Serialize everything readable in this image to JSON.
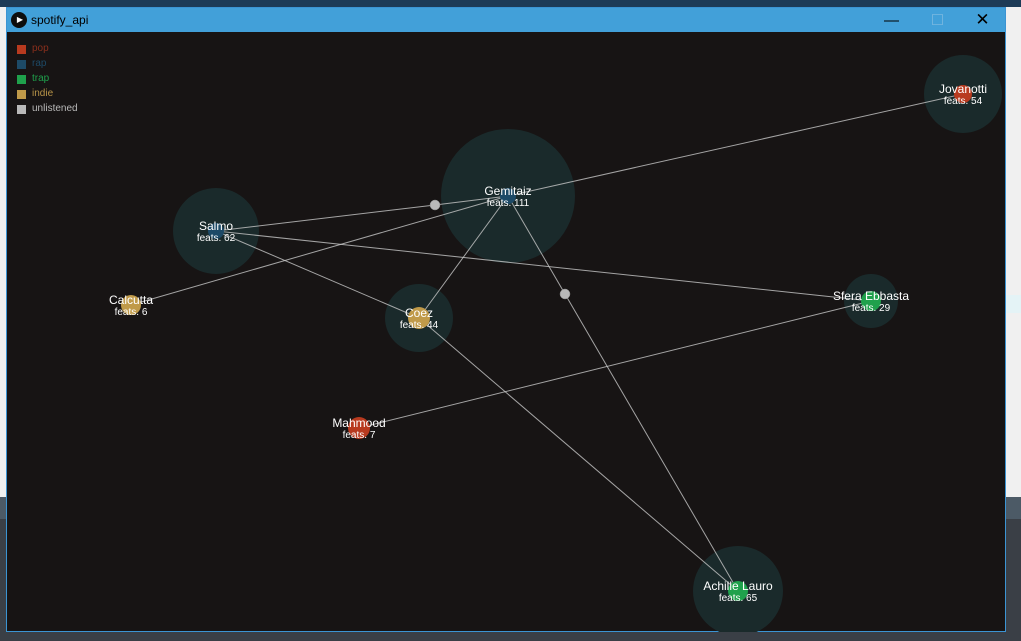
{
  "window": {
    "title": "spotify_api",
    "app_icon": "play-icon",
    "minimize_icon": "minimize-icon",
    "maximize_icon": "maximize-icon",
    "close_icon": "close-icon"
  },
  "legend": [
    {
      "label": "pop",
      "color": "#b83a1f",
      "text_color": "#8a2f1c"
    },
    {
      "label": "rap",
      "color": "#1d4a67",
      "text_color": "#1d4a67"
    },
    {
      "label": "trap",
      "color": "#1fa14c",
      "text_color": "#1fa14c"
    },
    {
      "label": "indie",
      "color": "#c09a49",
      "text_color": "#b89448"
    },
    {
      "label": "unlistened",
      "color": "#b9b9b9",
      "text_color": "#b9b9b9"
    }
  ],
  "graph": {
    "halo_color": "#1a2a2b",
    "edge_color": "#c8c8c8",
    "nodes": [
      {
        "id": "gemitaiz",
        "name": "Gemitaiz",
        "feats_label": "feats. 111",
        "genre": "rap"
      },
      {
        "id": "salmo",
        "name": "Salmo",
        "feats_label": "feats. 62",
        "genre": "rap"
      },
      {
        "id": "jovanotti",
        "name": "Jovanotti",
        "feats_label": "feats. 54",
        "genre": "pop"
      },
      {
        "id": "calcutta",
        "name": "Calcutta",
        "feats_label": "feats. 6",
        "genre": "indie"
      },
      {
        "id": "coez",
        "name": "Coez",
        "feats_label": "feats. 44",
        "genre": "indie"
      },
      {
        "id": "sfera",
        "name": "Sfera Ebbasta",
        "feats_label": "feats. 29",
        "genre": "trap"
      },
      {
        "id": "mahmood",
        "name": "Mahmood",
        "feats_label": "feats. 7",
        "genre": "pop"
      },
      {
        "id": "achille",
        "name": "Achille Lauro",
        "feats_label": "feats. 65",
        "genre": "trap"
      }
    ],
    "edges": [
      [
        "salmo",
        "unl1"
      ],
      [
        "unl1",
        "gemitaiz"
      ],
      [
        "salmo",
        "coez"
      ],
      [
        "salmo",
        "sfera"
      ],
      [
        "calcutta",
        "gemitaiz"
      ],
      [
        "coez",
        "gemitaiz"
      ],
      [
        "coez",
        "achille"
      ],
      [
        "gemitaiz",
        "jovanotti"
      ],
      [
        "gemitaiz",
        "unl2"
      ],
      [
        "unl2",
        "achille"
      ],
      [
        "mahmood",
        "sfera"
      ]
    ],
    "unlistened_nodes": [
      "unl1",
      "unl2"
    ]
  }
}
